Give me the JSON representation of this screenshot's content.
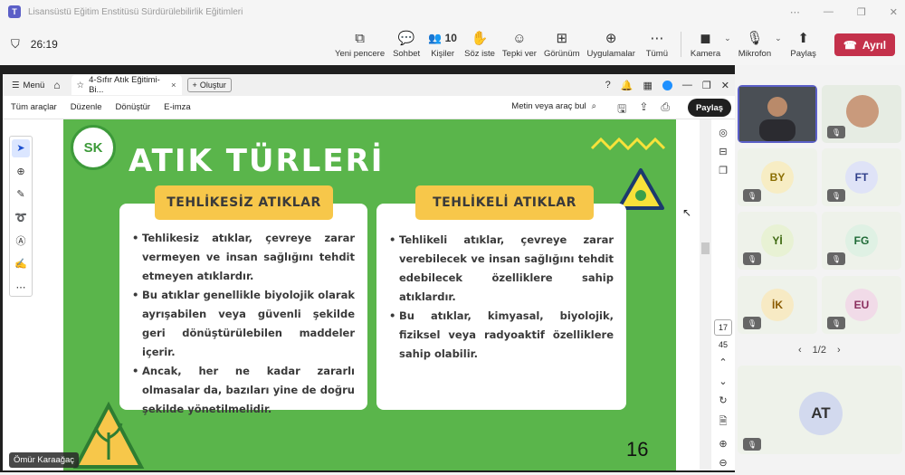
{
  "window": {
    "title": "Lisansüstü Eğitim Enstitüsü Sürdürülebilirlik Eğitimleri"
  },
  "meeting": {
    "timer": "26:19",
    "tools": [
      {
        "icon": "share-window-icon",
        "glyph": "⧉",
        "label": "Yeni pencere"
      },
      {
        "icon": "chat-icon",
        "glyph": "💬",
        "label": "Sohbet"
      },
      {
        "icon": "people-icon",
        "glyph": "👥 10",
        "label": "Kişiler"
      },
      {
        "icon": "raise-hand-icon",
        "glyph": "✋",
        "label": "Söz iste"
      },
      {
        "icon": "react-icon",
        "glyph": "☺",
        "label": "Tepki ver"
      },
      {
        "icon": "view-icon",
        "glyph": "⊞",
        "label": "Görünüm"
      },
      {
        "icon": "apps-icon",
        "glyph": "⊕",
        "label": "Uygulamalar"
      },
      {
        "icon": "more-icon",
        "glyph": "⋯",
        "label": "Tümü"
      }
    ],
    "camera_label": "Kamera",
    "mic_label": "Mikrofon",
    "share_label": "Paylaş",
    "leave_label": "Ayrıl"
  },
  "browser": {
    "menu_label": "Menü",
    "tab_title": "4-Sıfır Atık Eğitimi-Bi...",
    "new_label": "Oluştur"
  },
  "pdf": {
    "menus": [
      "Tüm araçlar",
      "Düzenle",
      "Dönüştür",
      "E-imza"
    ],
    "search_label": "Metin veya araç bul",
    "share_label": "Paylaş",
    "page_current": "17",
    "page_total": "45"
  },
  "slide": {
    "logo_text": "SK",
    "title": "ATIK TÜRLERİ",
    "left_header": "TEHLİKESİZ ATIKLAR",
    "left_points": [
      "Tehlikesiz atıklar, çevreye zarar vermeyen ve insan sağlığını tehdit etmeyen atıklardır.",
      "Bu atıklar genellikle biyolojik olarak ayrışabilen veya güvenli şekilde geri dönüştürülebilen maddeler içerir.",
      "Ancak, her ne kadar zararlı olmasalar da, bazıları yine de doğru şekilde yönetilmelidir."
    ],
    "right_header": "TEHLİKELİ ATIKLAR",
    "right_points": [
      "Tehlikeli atıklar, çevreye zarar verebilecek ve insan sağlığını tehdit edebilecek özelliklere sahip atıklardır.",
      "Bu atıklar, kimyasal, biyolojik, fiziksel veya radyoaktif özelliklere sahip olabilir."
    ],
    "page_number": "16"
  },
  "presenter_name": "Ömür Karaağaç",
  "participants": [
    {
      "initials": "BY",
      "color": "#f7edc4",
      "text": "#8a6d00"
    },
    {
      "initials": "FT",
      "color": "#dfe3f7",
      "text": "#2f3f8a"
    },
    {
      "initials": "Yİ",
      "color": "#e8f2d4",
      "text": "#3f6a12"
    },
    {
      "initials": "FG",
      "color": "#dff1e4",
      "text": "#1f6a37"
    },
    {
      "initials": "İK",
      "color": "#f7eac4",
      "text": "#8a5a00"
    },
    {
      "initials": "EU",
      "color": "#f1dbe8",
      "text": "#8a2f5e"
    }
  ],
  "pager": "1/2",
  "big_participant": "AT"
}
